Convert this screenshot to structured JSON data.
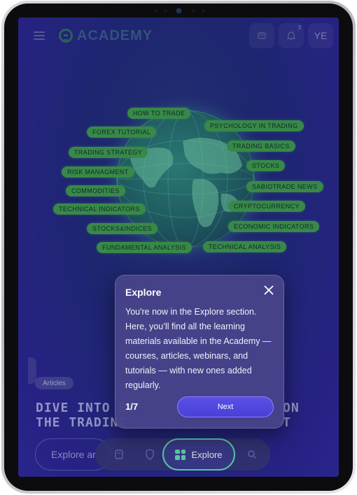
{
  "header": {
    "logo_text": "ACADEMY",
    "notifications_count": "3",
    "avatar_initials": "YE"
  },
  "globe_tags": [
    "HOW TO TRADE",
    "FOREX TUTORIAL",
    "TRADING STRATEGY",
    "RISK MANAGMENT",
    "COMMODITIES",
    "TECHNICAL INDICATORS",
    "STOCKS&INDICES",
    "FUNDAMENTAL ANALYSIS",
    "PSYCHOLOGY IN TRADING",
    "TRADING BASICS",
    "STOCKS",
    "SABIOTRADE NEWS",
    "CRYPTOCURRENCY",
    "ECONOMIC INDICATORS",
    "TECHNICAL ANALYSIS"
  ],
  "main": {
    "chip_label": "Articles",
    "headline_line1": "DIVE INTO EX",
    "headline_line2": "THE TRADING",
    "headline_line1_right": "ON",
    "headline_line2_right": "T",
    "explore_input_text": "Explore ar"
  },
  "bottom_nav": {
    "explore_label": "Explore"
  },
  "tooltip": {
    "title": "Explore",
    "body": "You're now in the Explore section. Here, you’ll find all the learning materials available in the Academy — courses, articles, webinars, and tutorials — with new ones added regularly.",
    "step": "1/7",
    "next_label": "Next"
  }
}
